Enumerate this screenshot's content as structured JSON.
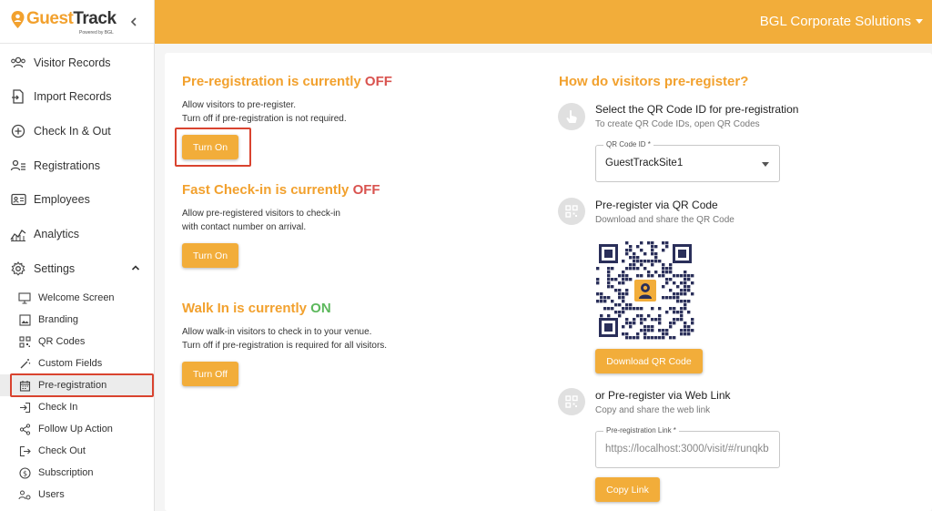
{
  "brand": {
    "logo_guest": "Guest",
    "logo_track": "Track",
    "logo_sub": "Powered by BGL"
  },
  "header": {
    "company": "BGL Corporate Solutions"
  },
  "sidebar": {
    "items": [
      {
        "label": "Visitor Records"
      },
      {
        "label": "Import Records"
      },
      {
        "label": "Check In & Out"
      },
      {
        "label": "Registrations"
      },
      {
        "label": "Employees"
      },
      {
        "label": "Analytics"
      },
      {
        "label": "Settings"
      }
    ],
    "settings_items": [
      {
        "label": "Welcome Screen"
      },
      {
        "label": "Branding"
      },
      {
        "label": "QR Codes"
      },
      {
        "label": "Custom Fields"
      },
      {
        "label": "Pre-registration"
      },
      {
        "label": "Check In"
      },
      {
        "label": "Follow Up Action"
      },
      {
        "label": "Check Out"
      },
      {
        "label": "Subscription"
      },
      {
        "label": "Users"
      }
    ]
  },
  "prereg": {
    "title": "Pre-registration is currently ",
    "status": "OFF",
    "desc1": "Allow visitors to pre-register.",
    "desc2": "Turn off if pre-registration is not required.",
    "button": "Turn On"
  },
  "fastcheckin": {
    "title": "Fast Check-in is currently ",
    "status": "OFF",
    "desc1": "Allow pre-registered visitors to check-in",
    "desc2": "with contact number on arrival.",
    "button": "Turn On"
  },
  "walkin": {
    "title": "Walk In is currently ",
    "status": "ON",
    "desc1": "Allow walk-in visitors to check in to your venue.",
    "desc2": "Turn off if pre-registration is required for all visitors.",
    "button": "Turn Off"
  },
  "how": {
    "title": "How do visitors pre-register?",
    "step1_title": "Select the QR Code ID for pre-registration",
    "step1_sub": "To create QR Code IDs, open QR Codes",
    "qr_field_label": "QR Code ID *",
    "qr_field_value": "GuestTrackSite1",
    "step2_title": "Pre-register via QR Code",
    "step2_sub": "Download and share the QR Code",
    "download_button": "Download QR Code",
    "step3_title": "or Pre-register via Web Link",
    "step3_sub": "Copy and share the web link",
    "link_field_label": "Pre-registration Link *",
    "link_field_value": "https://localhost:3000/visit/#/runqkb",
    "copy_button": "Copy Link"
  },
  "colors": {
    "accent": "#f2ad3a",
    "off": "#d9534f",
    "on": "#5cb85c",
    "highlight": "#d9432f"
  }
}
